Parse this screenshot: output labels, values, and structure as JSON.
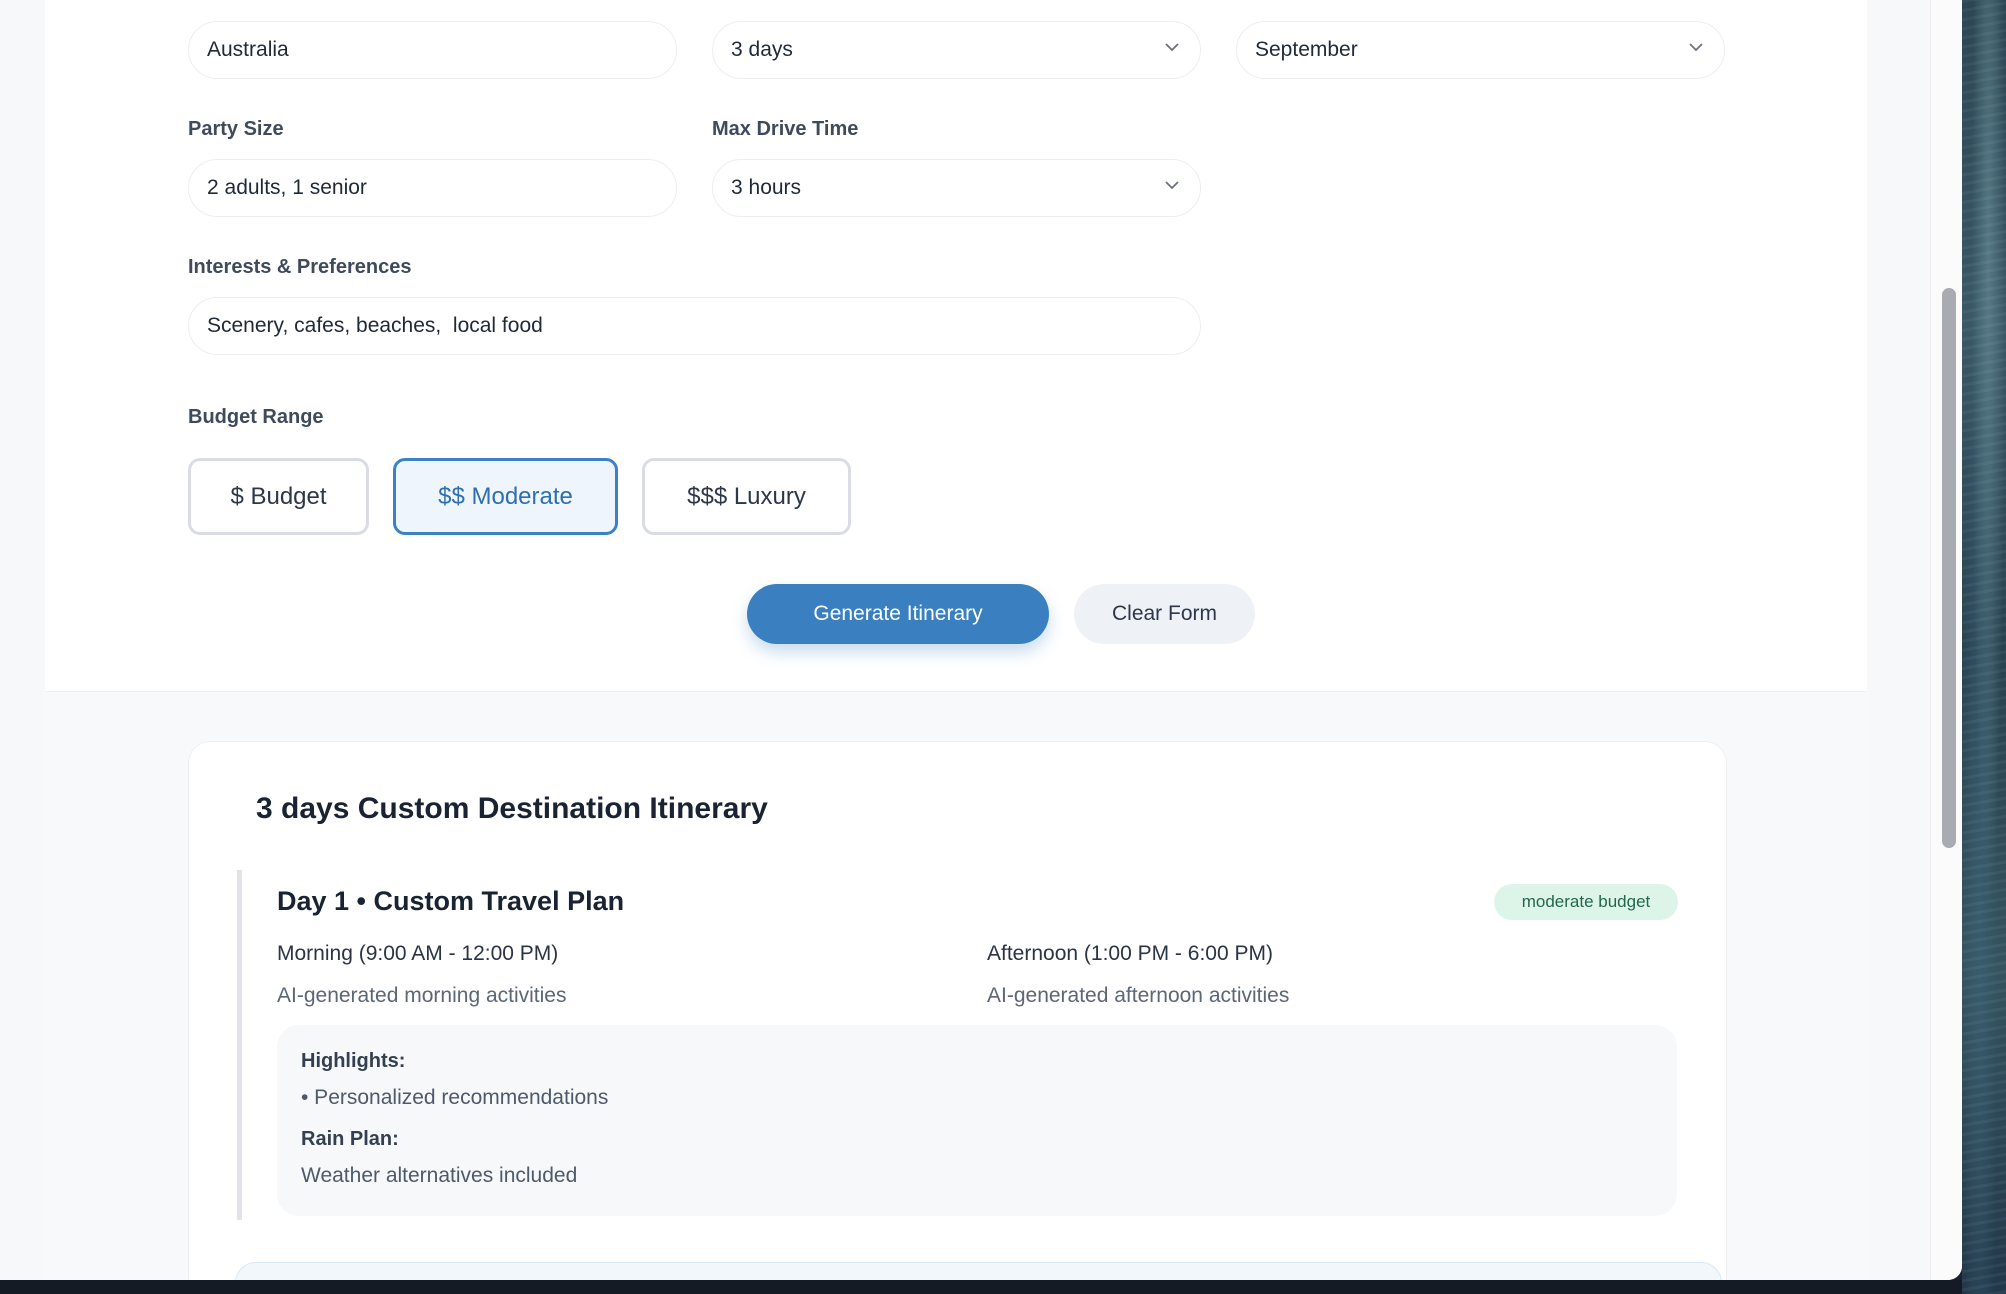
{
  "form": {
    "destination": {
      "value": "Australia"
    },
    "trip_length": {
      "value": "3 days"
    },
    "month": {
      "value": "September"
    },
    "party_size": {
      "label": "Party Size",
      "value": "2 adults, 1 senior"
    },
    "max_drive": {
      "label": "Max Drive Time",
      "value": "3 hours"
    },
    "interests": {
      "label": "Interests & Preferences",
      "value": "Scenery, cafes, beaches,  local food"
    },
    "budget": {
      "label": "Budget Range",
      "options": [
        "$ Budget",
        "$$ Moderate",
        "$$$ Luxury"
      ],
      "selected": "$$ Moderate"
    },
    "actions": {
      "generate": "Generate Itinerary",
      "clear": "Clear Form"
    }
  },
  "itinerary": {
    "title": "3 days Custom Destination Itinerary",
    "days": [
      {
        "title": "Day 1 • Custom Travel Plan",
        "badge": "moderate budget",
        "morning": {
          "title": "Morning (9:00 AM - 12:00 PM)",
          "desc": "AI-generated morning activities"
        },
        "afternoon": {
          "title": "Afternoon (1:00 PM - 6:00 PM)",
          "desc": "AI-generated afternoon activities"
        },
        "highlights_label": "Highlights:",
        "highlights": [
          "• Personalized recommendations"
        ],
        "rain_plan_label": "Rain Plan:",
        "rain_plan": "Weather alternatives included"
      }
    ]
  },
  "colors": {
    "accent": "#3a80c0",
    "badge_bg": "#dcf5e8",
    "badge_text": "#22684a"
  },
  "icons": {
    "dropdown": "chevron-down-icon"
  }
}
